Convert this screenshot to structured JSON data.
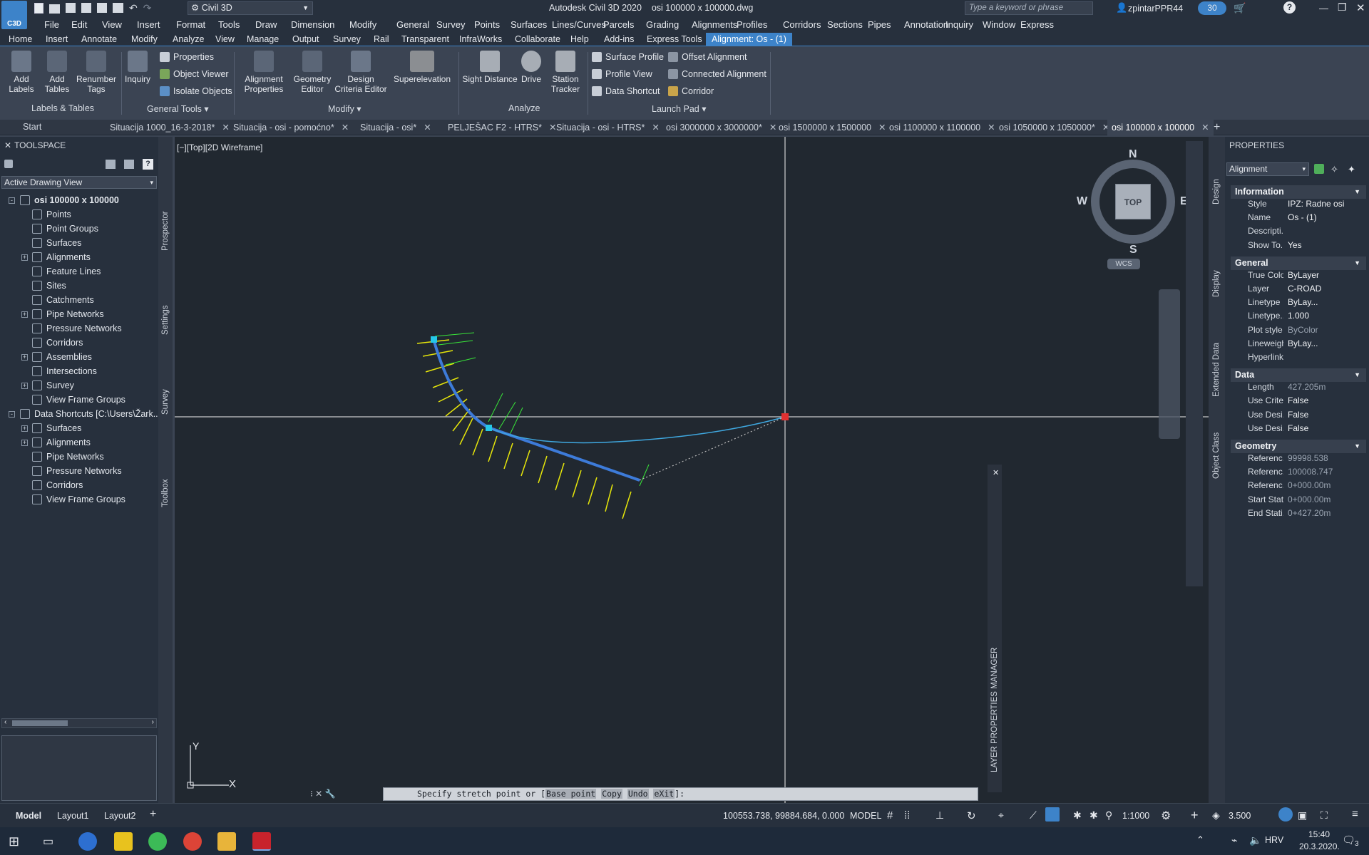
{
  "app": {
    "badge": "C3D",
    "title": "Autodesk Civil 3D 2020",
    "filename": "osi 100000 x 100000.dwg",
    "workspace": "Civil 3D",
    "search_placeholder": "Type a keyword or phrase",
    "user": "zpintarPPR44",
    "clock_badge": "30"
  },
  "menubar": [
    "File",
    "Edit",
    "View",
    "Insert",
    "Format",
    "Tools",
    "Draw",
    "Dimension",
    "Modify",
    "General",
    "Survey",
    "Points",
    "Surfaces",
    "Lines/Curves",
    "Parcels",
    "Grading",
    "Alignments",
    "Profiles",
    "Corridors",
    "Sections",
    "Pipes",
    "Annotation",
    "Inquiry",
    "Window",
    "Express"
  ],
  "ribbon_tabs": [
    "Home",
    "Insert",
    "Annotate",
    "Modify",
    "Analyze",
    "View",
    "Manage",
    "Output",
    "Survey",
    "Rail",
    "Transparent",
    "InfraWorks",
    "Collaborate",
    "Help",
    "Add-ins",
    "Express Tools"
  ],
  "ribbon_active_tab": "Alignment: Os - (1)",
  "ribbon": {
    "labels_tables": {
      "title": "Labels & Tables",
      "add_labels": "Add Labels",
      "add_tables": "Add Tables",
      "renumber_tags": "Renumber Tags"
    },
    "general_tools": {
      "title": "General Tools",
      "inquiry": "Inquiry",
      "properties": "Properties",
      "object_viewer": "Object Viewer",
      "isolate_objects": "Isolate Objects"
    },
    "modify": {
      "title": "Modify",
      "alignment_properties": "Alignment Properties",
      "geometry_editor": "Geometry Editor",
      "design_criteria_editor": "Design Criteria Editor",
      "superelevation": "Superelevation"
    },
    "analyze": {
      "title": "Analyze",
      "sight_distance": "Sight Distance",
      "drive": "Drive",
      "station_tracker": "Station Tracker"
    },
    "launch_pad": {
      "title": "Launch Pad",
      "surface_profile": "Surface Profile",
      "profile_view": "Profile View",
      "data_shortcut": "Data Shortcut",
      "offset_alignment": "Offset Alignment",
      "connected_alignment": "Connected Alignment",
      "corridor": "Corridor"
    }
  },
  "doc_tabs": [
    "Start",
    "Situacija 1000_16-3-2018*",
    "Situacija - osi - pomoćno*",
    "Situacija - osi*",
    "PELJEŠAC F2 - HTRS*",
    "Situacija - osi - HTRS*",
    "osi 3000000 x 3000000*",
    "osi 1500000 x 1500000",
    "osi 1100000 x 1100000",
    "osi 1050000 x 1050000*",
    "osi 100000 x 100000"
  ],
  "toolspace": {
    "title": "TOOLSPACE",
    "view_select": "Active Drawing View",
    "side_tabs": [
      "Prospector",
      "Settings",
      "Survey",
      "Toolbox"
    ],
    "tree": [
      {
        "label": "osi 100000 x 100000",
        "level": 0,
        "bold": true,
        "expander": "-"
      },
      {
        "label": "Points",
        "level": 1
      },
      {
        "label": "Point Groups",
        "level": 1
      },
      {
        "label": "Surfaces",
        "level": 1
      },
      {
        "label": "Alignments",
        "level": 1,
        "expander": "+"
      },
      {
        "label": "Feature Lines",
        "level": 1
      },
      {
        "label": "Sites",
        "level": 1
      },
      {
        "label": "Catchments",
        "level": 1
      },
      {
        "label": "Pipe Networks",
        "level": 1,
        "expander": "+"
      },
      {
        "label": "Pressure Networks",
        "level": 1
      },
      {
        "label": "Corridors",
        "level": 1
      },
      {
        "label": "Assemblies",
        "level": 1,
        "expander": "+"
      },
      {
        "label": "Intersections",
        "level": 1
      },
      {
        "label": "Survey",
        "level": 1,
        "expander": "+"
      },
      {
        "label": "View Frame Groups",
        "level": 1
      },
      {
        "label": "Data Shortcuts [C:\\Users\\Žark...",
        "level": 0,
        "expander": "-"
      },
      {
        "label": "Surfaces",
        "level": 1,
        "expander": "+"
      },
      {
        "label": "Alignments",
        "level": 1,
        "expander": "+"
      },
      {
        "label": "Pipe Networks",
        "level": 1
      },
      {
        "label": "Pressure Networks",
        "level": 1
      },
      {
        "label": "Corridors",
        "level": 1
      },
      {
        "label": "View Frame Groups",
        "level": 1
      }
    ]
  },
  "viewport": {
    "label": "[−][Top][2D Wireframe]",
    "viewcube": {
      "top": "TOP",
      "n": "N",
      "s": "S",
      "e": "E",
      "w": "W",
      "wcs": "WCS"
    },
    "ucs_x": "X",
    "ucs_y": "Y",
    "lpm_label": "LAYER PROPERTIES MANAGER"
  },
  "command": {
    "prompt": "Specify stretch point or [",
    "opts": [
      "Base point",
      "Copy",
      "Undo",
      "eXit"
    ],
    "end": "]:"
  },
  "properties": {
    "title": "PROPERTIES",
    "type": "Alignment",
    "side_tabs": [
      "Design",
      "Display",
      "Extended Data",
      "Object Class"
    ],
    "sections": [
      {
        "name": "Information",
        "rows": [
          [
            "Style",
            "IPZ: Radne osi"
          ],
          [
            "Name",
            "Os - (1)"
          ],
          [
            "Descripti...",
            ""
          ],
          [
            "Show To...",
            "Yes"
          ]
        ]
      },
      {
        "name": "General",
        "rows": [
          [
            "True Color",
            "ByLayer"
          ],
          [
            "Layer",
            "C-ROAD"
          ],
          [
            "Linetype",
            "ByLay..."
          ],
          [
            "Linetype...",
            "1.000"
          ],
          [
            "Plot style",
            "ByColor"
          ],
          [
            "Lineweight",
            "ByLay..."
          ],
          [
            "Hyperlink",
            ""
          ]
        ]
      },
      {
        "name": "Data",
        "rows": [
          [
            "Length",
            "427.205m"
          ],
          [
            "Use Crite...",
            "False"
          ],
          [
            "Use Desi...",
            "False"
          ],
          [
            "Use Desi...",
            "False"
          ]
        ]
      },
      {
        "name": "Geometry",
        "rows": [
          [
            "Referenc...",
            "99998.538"
          ],
          [
            "Referenc...",
            "100008.747"
          ],
          [
            "Referenc...",
            "0+000.00m"
          ],
          [
            "Start Stat...",
            "0+000.00m"
          ],
          [
            "End Stati...",
            "0+427.20m"
          ]
        ]
      }
    ]
  },
  "status": {
    "layout_tabs": [
      "Model",
      "Layout1",
      "Layout2"
    ],
    "coords": "100553.738, 99884.684, 0.000",
    "model": "MODEL",
    "scale": "1:1000",
    "annoscale": "3.500"
  },
  "taskbar": {
    "lang": "HRV",
    "time": "15:40",
    "date": "20.3.2020.",
    "notif": "3"
  }
}
